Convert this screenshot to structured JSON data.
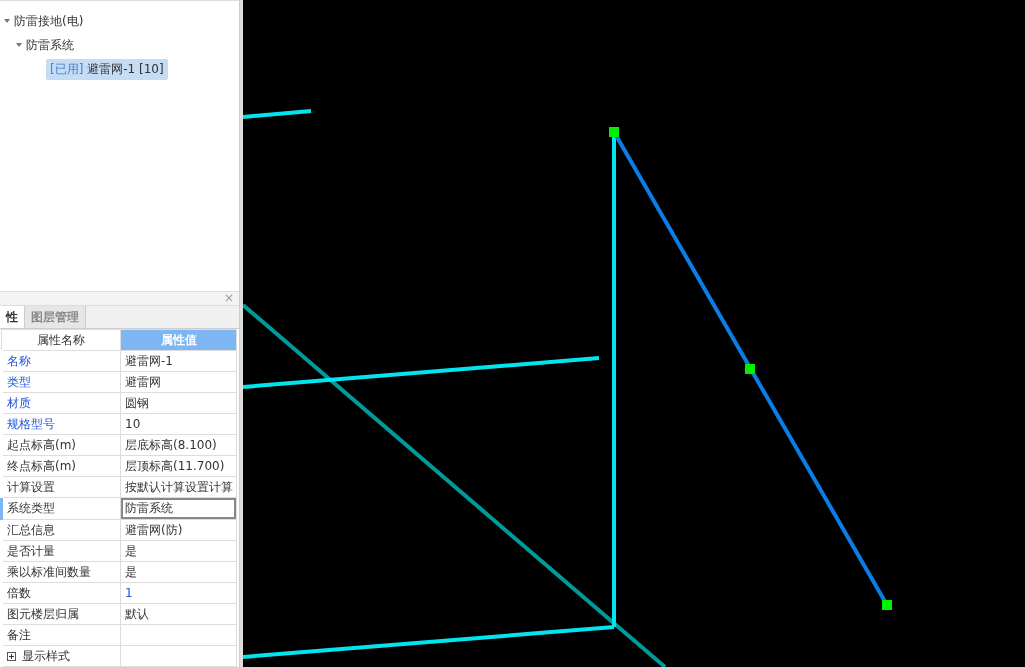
{
  "tree": [
    {
      "label": "防雷接地(电)",
      "expanded": true,
      "children": [
        {
          "label": "防雷系统",
          "expanded": true,
          "children": [
            {
              "tag": "[已用]",
              "label": "避雷网-1 [10]",
              "selected": true
            }
          ]
        }
      ]
    }
  ],
  "panel": {
    "close": "×",
    "tabs": [
      {
        "label": "性",
        "selected": true
      },
      {
        "label": "图层管理",
        "selected": false
      }
    ],
    "columns": [
      "属性名称",
      "属性值"
    ],
    "rows": [
      {
        "name": "名称",
        "value": "避雷网-1",
        "name_highlighted": true,
        "value_highlighted": false,
        "selected": false
      },
      {
        "name": "类型",
        "value": "避雷网",
        "name_highlighted": true,
        "value_highlighted": false,
        "selected": false
      },
      {
        "name": "材质",
        "value": "圆钢",
        "name_highlighted": true,
        "value_highlighted": false,
        "selected": false
      },
      {
        "name": "规格型号",
        "value": "10",
        "name_highlighted": true,
        "value_highlighted": false,
        "selected": false
      },
      {
        "name": "起点标高(m)",
        "value": "层底标高(8.100)",
        "name_highlighted": false,
        "value_highlighted": false,
        "selected": false
      },
      {
        "name": "终点标高(m)",
        "value": "层顶标高(11.700)",
        "name_highlighted": false,
        "value_highlighted": false,
        "selected": false
      },
      {
        "name": "计算设置",
        "value": "按默认计算设置计算",
        "name_highlighted": false,
        "value_highlighted": false,
        "selected": false
      },
      {
        "name": "系统类型",
        "value": "防雷系统",
        "name_highlighted": false,
        "value_highlighted": false,
        "selected": true
      },
      {
        "name": "汇总信息",
        "value": "避雷网(防)",
        "name_highlighted": false,
        "value_highlighted": false,
        "selected": false
      },
      {
        "name": "是否计量",
        "value": "是",
        "name_highlighted": false,
        "value_highlighted": false,
        "selected": false
      },
      {
        "name": "乘以标准间数量",
        "value": "是",
        "name_highlighted": false,
        "value_highlighted": false,
        "selected": false
      },
      {
        "name": "倍数",
        "value": "1",
        "name_highlighted": false,
        "value_highlighted": true,
        "selected": false
      },
      {
        "name": "图元楼层归属",
        "value": "默认",
        "name_highlighted": false,
        "value_highlighted": false,
        "selected": false
      },
      {
        "name": "备注",
        "name_highlighted": false,
        "selected": false
      },
      {
        "name": "显示样式",
        "kind": "group",
        "expanded": false,
        "name_highlighted": false,
        "selected": false
      }
    ]
  }
}
